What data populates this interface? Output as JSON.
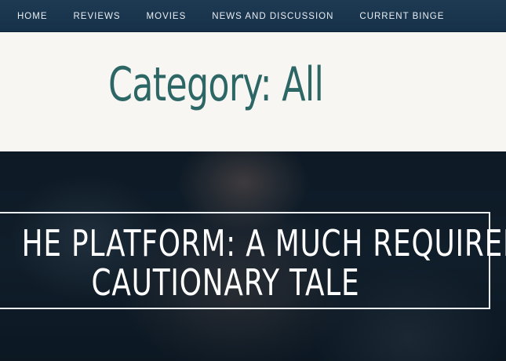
{
  "nav": {
    "items": [
      {
        "label": "HOME"
      },
      {
        "label": "REVIEWS"
      },
      {
        "label": "MOVIES"
      },
      {
        "label": "NEWS AND DISCUSSION"
      },
      {
        "label": "CURRENT BINGE"
      }
    ]
  },
  "header": {
    "title": "Category: All"
  },
  "featured": {
    "title_line1": "HE PLATFORM: A MUCH REQUIRED",
    "title_line2": "CAUTIONARY TALE"
  },
  "colors": {
    "nav_bg": "#16304a",
    "title": "#2c6766",
    "header_bg": "#f8f6f3"
  }
}
